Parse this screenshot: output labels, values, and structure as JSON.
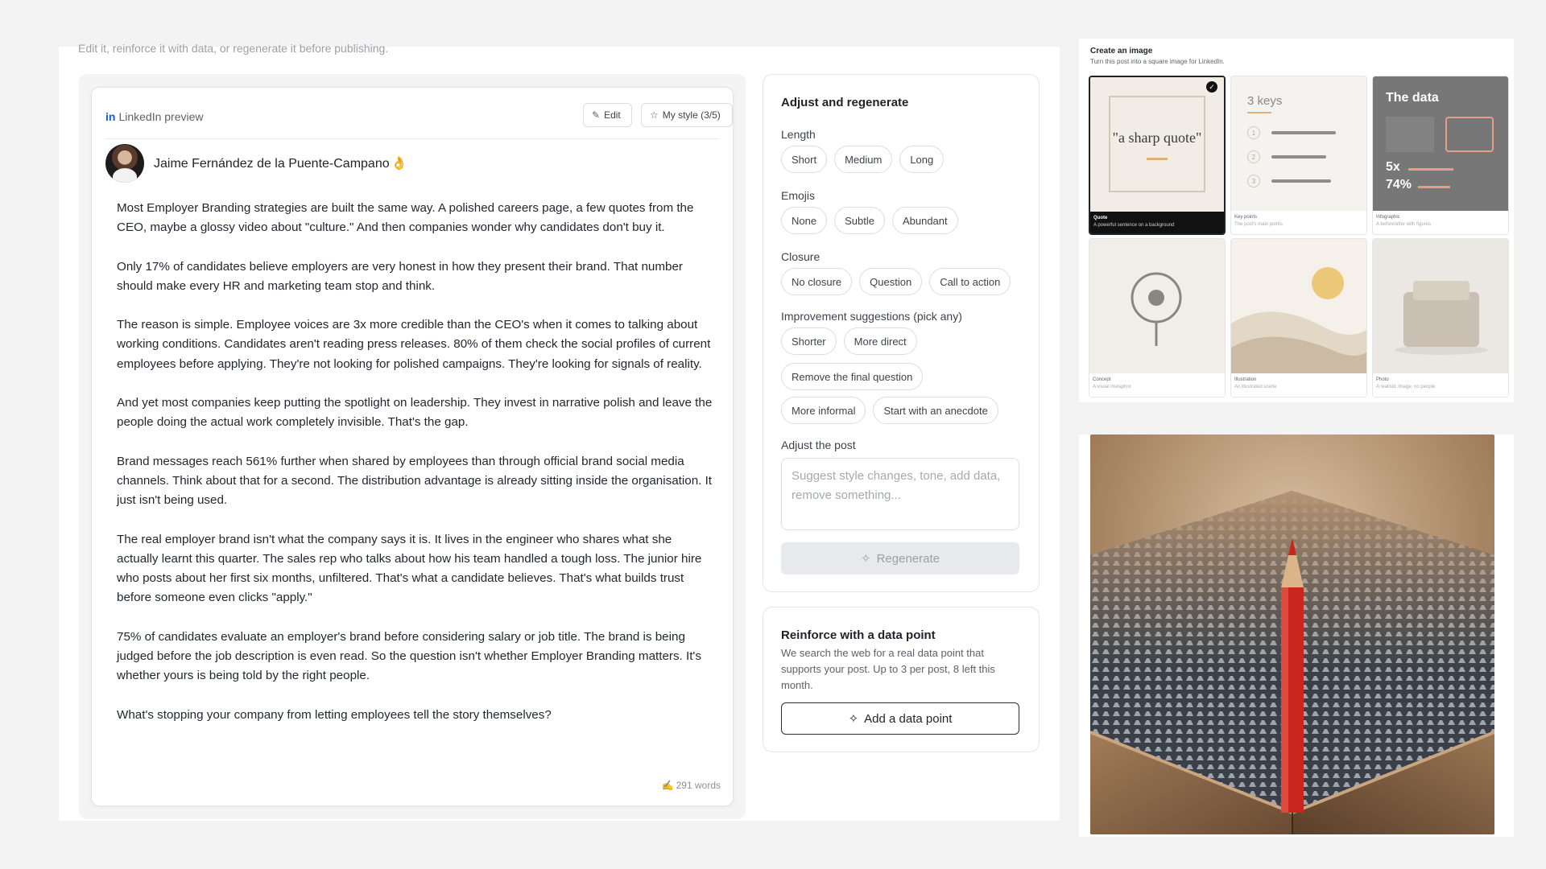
{
  "intro": {
    "text": "Edit it, reinforce it with data, or regenerate it before publishing."
  },
  "preview": {
    "label_prefix": "in",
    "label": "LinkedIn preview",
    "edit_label": "Edit",
    "style_label": "My style (3/5)",
    "author_name": "Jaime Fernández de la Puente-Campano",
    "author_emoji": "👌",
    "paragraphs": [
      "Most Employer Branding strategies are built the same way. A polished careers page, a few quotes from the CEO, maybe a glossy video about \"culture.\" And then companies wonder why candidates don't buy it.",
      "Only 17% of candidates believe employers are very honest in how they present their brand. That number should make every HR and marketing team stop and think.",
      "The reason is simple. Employee voices are 3x more credible than the CEO's when it comes to talking about working conditions. Candidates aren't reading press releases. 80% of them check the social profiles of current employees before applying. They're not looking for polished campaigns. They're looking for signals of reality.",
      "And yet most companies keep putting the spotlight on leadership. They invest in narrative polish and leave the people doing the actual work completely invisible. That's the gap.",
      "Brand messages reach 561% further when shared by employees than through official brand social media channels. Think about that for a second. The distribution advantage is already sitting inside the organisation. It just isn't being used.",
      "The real employer brand isn't what the company says it is. It lives in the engineer who shares what she actually learnt this quarter. The sales rep who talks about how his team handled a tough loss. The junior hire who posts about her first six months, unfiltered. That's what a candidate believes. That's what builds trust before someone even clicks \"apply.\"",
      "75% of candidates evaluate an employer's brand before considering salary or job title. The brand is being judged before the job description is even read. So the question isn't whether Employer Branding matters. It's whether yours is being told by the right people.",
      "What's stopping your company from letting employees tell the story themselves?"
    ],
    "word_count": "291 words",
    "word_count_icon": "✍"
  },
  "adjust": {
    "title": "Adjust and regenerate",
    "length": {
      "label": "Length",
      "options": [
        "Short",
        "Medium",
        "Long"
      ]
    },
    "emojis": {
      "label": "Emojis",
      "options": [
        "None",
        "Subtle",
        "Abundant"
      ]
    },
    "closure": {
      "label": "Closure",
      "options": [
        "No closure",
        "Question",
        "Call to action"
      ]
    },
    "suggestions": {
      "label": "Improvement suggestions (pick any)",
      "row1": [
        "Shorter",
        "More direct"
      ],
      "row2": [
        "Remove the final question"
      ],
      "row3": [
        "More informal",
        "Start with an anecdote"
      ]
    },
    "adjust_post_label": "Adjust the post",
    "input_placeholder": "Suggest style changes, tone, add data, remove something...",
    "regenerate_label": "Regenerate"
  },
  "reinforce": {
    "title": "Reinforce with a data point",
    "description": "We search the web for a real data point that supports your post. Up to 3 per post, 8 left this month.",
    "button_label": "Add a data point"
  },
  "create_image": {
    "title": "Create an image",
    "subtitle": "Turn this post into a square image for LinkedIn.",
    "tiles": [
      {
        "name": "Quote",
        "desc": "A powerful sentence on a background",
        "art_text": "\"a sharp quote\"",
        "selected": true
      },
      {
        "name": "Key points",
        "desc": "The post's main points",
        "art_text": "3 keys",
        "key_numbers": [
          "1",
          "2",
          "3"
        ]
      },
      {
        "name": "Infographic",
        "desc": "A before/after with figures",
        "art_text": "The data",
        "stats": [
          "5x",
          "74%"
        ]
      },
      {
        "name": "Concept",
        "desc": "A visual metaphor"
      },
      {
        "name": "Illustration",
        "desc": "An illustrated scene"
      },
      {
        "name": "Photo",
        "desc": "A realistic image, no people"
      }
    ]
  },
  "colors": {
    "accent_dark": "#1f2329",
    "linkedin_blue": "#0a66c2",
    "pencil_red": "#c8261f",
    "infographic_bg": "#777778",
    "infographic_accent": "#e79c85"
  },
  "icons": {
    "edit": "pencil-icon",
    "style": "star-icon",
    "regenerate": "sparkle-icon",
    "add_data": "sparkle-icon",
    "selected": "check-icon",
    "word_count": "writing-hand-icon"
  }
}
